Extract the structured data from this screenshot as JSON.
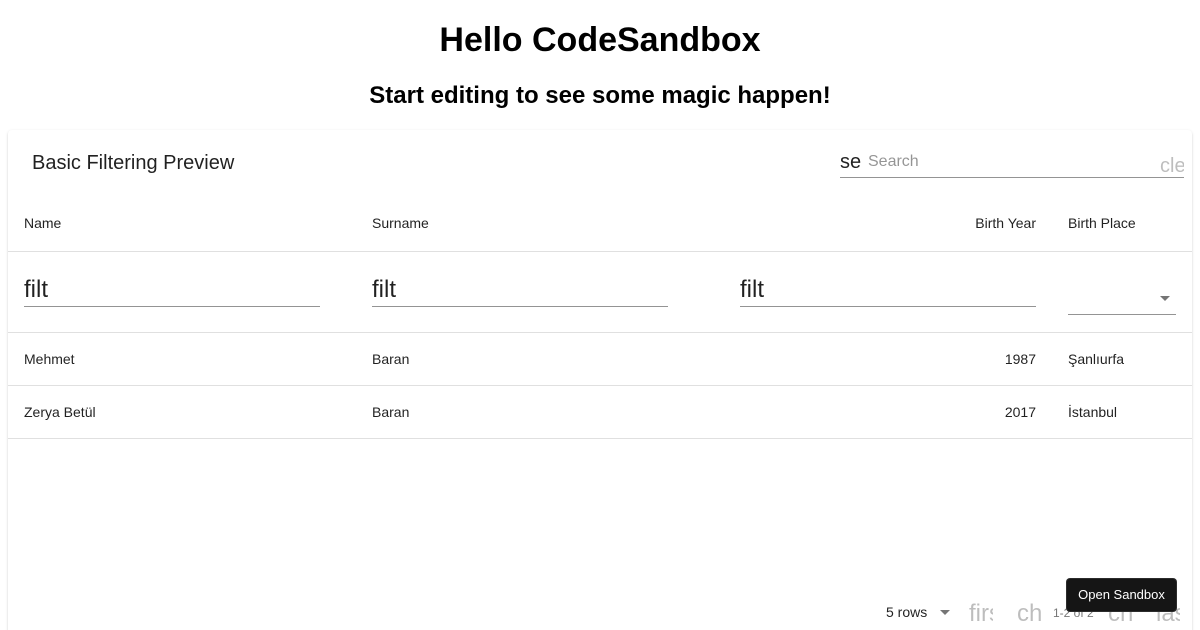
{
  "page": {
    "heading": "Hello CodeSandbox",
    "subheading": "Start editing to see some magic happen!"
  },
  "table": {
    "title": "Basic Filtering Preview",
    "search": {
      "icon_text": "se",
      "placeholder": "Search",
      "clear_icon_text": "cle"
    },
    "columns": [
      "Name",
      "Surname",
      "Birth Year",
      "Birth Place"
    ],
    "filter_icon_text": "filt",
    "rows": [
      [
        "Mehmet",
        "Baran",
        "1987",
        "Şanlıurfa"
      ],
      [
        "Zerya Betül",
        "Baran",
        "2017",
        "İstanbul"
      ]
    ],
    "pagination": {
      "rows_label": "5 rows",
      "first_icon_text": "first",
      "prev_icon_text": "ch",
      "caption": "1-2 of 2",
      "next_icon_text": "ch",
      "last_icon_text": "last"
    }
  },
  "open_sandbox_label": "Open Sandbox",
  "colors": {
    "text_primary": "#212121",
    "divider": "#e0e0e0",
    "button_bg": "#151515"
  },
  "icons": {
    "search": "search-icon",
    "clear": "clear-icon",
    "filter": "filter-list-icon",
    "first_page": "first-page-icon",
    "prev_page": "chevron-left-icon",
    "next_page": "chevron-right-icon",
    "last_page": "last-page-icon"
  }
}
